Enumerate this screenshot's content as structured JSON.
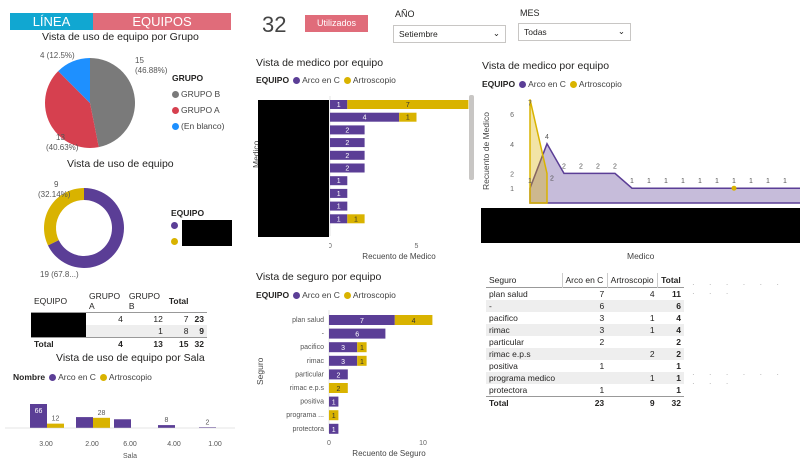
{
  "colors": {
    "purple": "#5b3e96",
    "gold": "#d9b300",
    "gray": "#7a7a7a",
    "red": "#d6404f",
    "blue": "#1e90ff",
    "linea": "#11a7d1",
    "equipos": "#e06c7a",
    "redact": "#000000"
  },
  "nav": {
    "linea": "LÍNEA",
    "equipos": "EQUIPOS"
  },
  "kpi": {
    "value": "32",
    "label": "Utilizados"
  },
  "filters": {
    "year_label": "AÑO",
    "year_value": "Setiembre",
    "month_label": "MES",
    "month_value": "Todas"
  },
  "pie": {
    "title": "Vista de uso de equipo por Grupo",
    "legend_title": "GRUPO",
    "slices": [
      {
        "name": "GRUPO B",
        "value": 15,
        "pct": "46.88%",
        "color": "#7a7a7a"
      },
      {
        "name": "GRUPO A",
        "value": 13,
        "pct": "40.63%",
        "color": "#d6404f"
      },
      {
        "name": "(En blanco)",
        "value": 4,
        "pct": "12.5%",
        "color": "#1e90ff"
      }
    ],
    "lab_b1": "15",
    "lab_b2": "(46.88%)",
    "lab_a1": "13",
    "lab_a2": "(40.63%)",
    "lab_c": "4 (12.5%)"
  },
  "donut": {
    "title": "Vista de uso de equipo",
    "legend_title": "EQUIPO",
    "values": [
      {
        "value": 19,
        "color": "#5b3e96"
      },
      {
        "value": 9,
        "color": "#d9b300"
      }
    ],
    "lab_a": "9",
    "lab_b": "(32.14%)",
    "lab_c": "19 (67.8...)"
  },
  "grp_table": {
    "headers": [
      "EQUIPO",
      "GRUPO A",
      "GRUPO B",
      "Total"
    ],
    "rows": [
      [
        "",
        "4",
        "12",
        "7",
        "23"
      ],
      [
        "",
        "",
        "1",
        "8",
        "9"
      ]
    ],
    "total": [
      "Total",
      "4",
      "13",
      "15",
      "32"
    ]
  },
  "sala": {
    "title": "Vista de uso de equipo por Sala",
    "legend_name": "Nombre",
    "xlabel": "Sala"
  },
  "bar_medico": {
    "title": "Vista de medico por equipo",
    "legend_name": "EQUIPO",
    "ylabel": "Medico",
    "xlabel": "Recuento de Medico",
    "ticks": [
      "0",
      "5"
    ]
  },
  "seguro_bar": {
    "title": "Vista de seguro por equipo",
    "legend_name": "EQUIPO",
    "ylabel": "Seguro",
    "xlabel": "Recuento de Seguro",
    "ticks": [
      "0",
      "10"
    ]
  },
  "area": {
    "title": "Vista de medico por equipo",
    "legend_name": "EQUIPO",
    "ylabel": "Recuento de Medico",
    "xlabel": "Medico"
  },
  "seg_table": {
    "headers": [
      "Seguro",
      "Arco en C",
      "Artroscopio",
      "Total"
    ],
    "rows": [
      [
        "plan salud",
        "7",
        "4",
        "11"
      ],
      [
        "-",
        "6",
        "",
        "6"
      ],
      [
        "pacifico",
        "3",
        "1",
        "4"
      ],
      [
        "rimac",
        "3",
        "1",
        "4"
      ],
      [
        "particular",
        "2",
        "",
        "2"
      ],
      [
        "rimac e.p.s",
        "",
        "2",
        "2"
      ],
      [
        "positiva",
        "1",
        "",
        "1"
      ],
      [
        "programa medico",
        "",
        "1",
        "1"
      ],
      [
        "protectora",
        "1",
        "",
        "1"
      ]
    ],
    "total": [
      "Total",
      "23",
      "9",
      "32"
    ]
  },
  "chart_data": [
    {
      "type": "pie",
      "title": "Vista de uso de equipo por Grupo",
      "categories": [
        "GRUPO B",
        "GRUPO A",
        "(En blanco)"
      ],
      "values": [
        15,
        13,
        4
      ],
      "legend": "right"
    },
    {
      "type": "pie",
      "title": "Vista de uso de equipo",
      "subtype": "donut",
      "values": [
        19,
        9
      ],
      "labels": [
        "19 (67.8...)",
        "9 (32.14%)"
      ]
    },
    {
      "type": "bar",
      "title": "Vista de uso de equipo por Sala",
      "xlabel": "Sala",
      "categories": [
        "3.00",
        "2.00",
        "6.00",
        "4.00",
        "1.00"
      ],
      "series": [
        {
          "name": "Arco en C",
          "values": [
            66,
            30,
            24,
            8,
            2
          ]
        },
        {
          "name": "Artroscopio",
          "values": [
            12,
            28,
            null,
            null,
            null
          ]
        }
      ]
    },
    {
      "type": "bar",
      "title": "Vista de medico por equipo",
      "orientation": "horizontal",
      "xlabel": "Recuento de Medico",
      "ylabel": "Medico",
      "series": [
        {
          "name": "Arco en C",
          "values": [
            1,
            4,
            2,
            2,
            2,
            2,
            1,
            1,
            1,
            1
          ]
        },
        {
          "name": "Artroscopio",
          "values": [
            7,
            1,
            null,
            null,
            null,
            null,
            null,
            null,
            null,
            1
          ]
        }
      ]
    },
    {
      "type": "bar",
      "title": "Vista de seguro por equipo",
      "orientation": "horizontal",
      "xlabel": "Recuento de Seguro",
      "ylabel": "Seguro",
      "categories": [
        "plan salud",
        "-",
        "pacifico",
        "rimac",
        "particular",
        "rimac e.p.s",
        "positiva",
        "programa ...",
        "protectora"
      ],
      "series": [
        {
          "name": "Arco en C",
          "values": [
            7,
            6,
            3,
            3,
            2,
            null,
            1,
            null,
            1
          ]
        },
        {
          "name": "Artroscopio",
          "values": [
            4,
            null,
            1,
            1,
            null,
            2,
            null,
            1,
            null
          ]
        }
      ]
    },
    {
      "type": "area",
      "title": "Vista de medico por equipo",
      "xlabel": "Medico",
      "ylabel": "Recuento de Medico",
      "series": [
        {
          "name": "Arco en C",
          "values": [
            1,
            4,
            2,
            2,
            2,
            2,
            1,
            1,
            1,
            1,
            1,
            1,
            1,
            1,
            1,
            1,
            1,
            1
          ]
        },
        {
          "name": "Artroscopio",
          "values": [
            7,
            2,
            null,
            null,
            null,
            null,
            null,
            null,
            null,
            null,
            null,
            null,
            1
          ]
        }
      ]
    }
  ]
}
